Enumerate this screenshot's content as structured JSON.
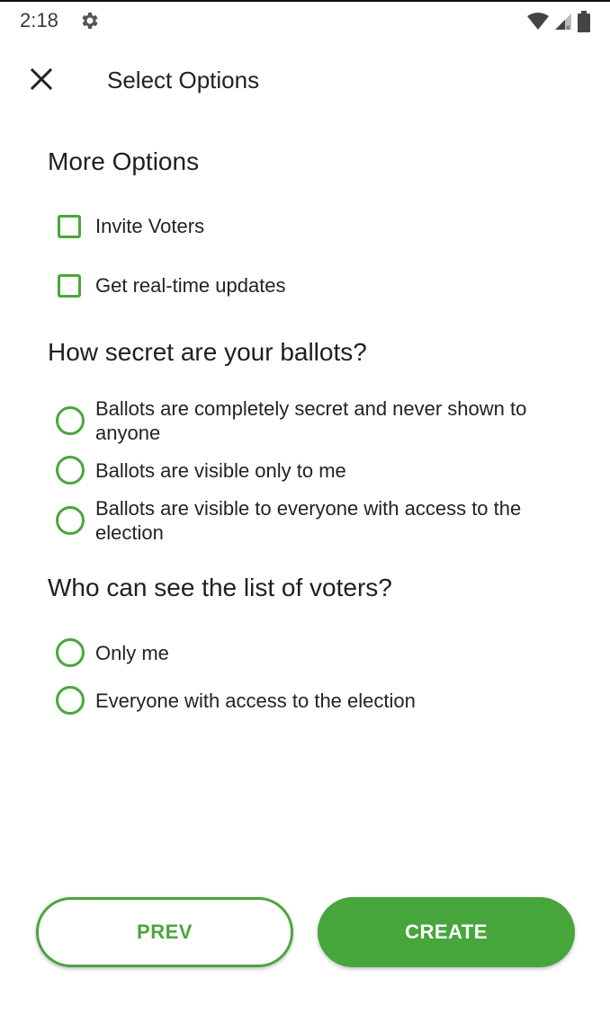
{
  "status_bar": {
    "time": "2:18",
    "icons": [
      "settings-gear-icon",
      "wifi-icon",
      "signal-icon",
      "battery-icon"
    ]
  },
  "app_bar": {
    "title": "Select Options",
    "close_icon": "close-icon"
  },
  "more_options": {
    "title": "More Options",
    "items": [
      {
        "label": "Invite Voters",
        "checked": false
      },
      {
        "label": "Get real-time updates",
        "checked": false
      }
    ]
  },
  "ballot_secrecy": {
    "title": "How secret are your ballots?",
    "options": [
      {
        "label": "Ballots are completely secret and never shown to anyone",
        "selected": false
      },
      {
        "label": "Ballots are visible only to me",
        "selected": false
      },
      {
        "label": "Ballots are visible to everyone with access to the election",
        "selected": false
      }
    ]
  },
  "voter_list": {
    "title": "Who can see the list of voters?",
    "options": [
      {
        "label": "Only me",
        "selected": false
      },
      {
        "label": "Everyone with access to the election",
        "selected": false
      }
    ]
  },
  "buttons": {
    "prev_label": "PREV",
    "create_label": "CREATE"
  },
  "colors": {
    "accent": "#47a63b",
    "text": "#202020"
  }
}
